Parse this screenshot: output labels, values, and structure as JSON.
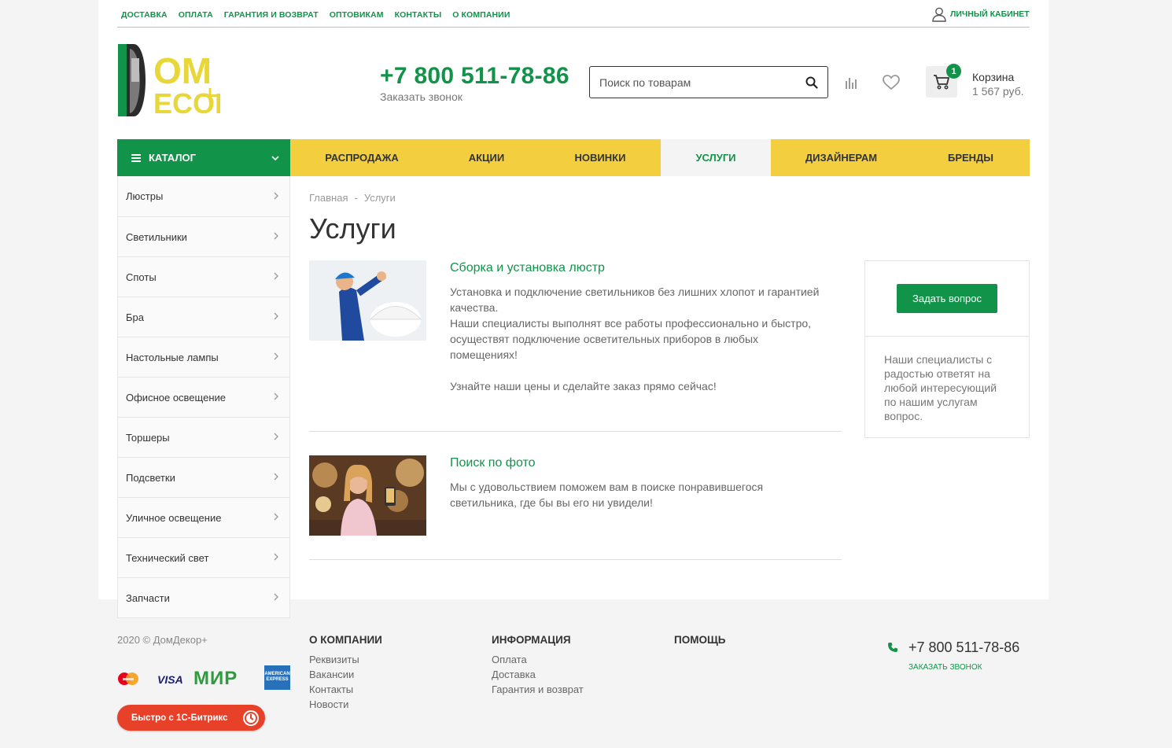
{
  "colors": {
    "brand_green": "#12934a",
    "nav_yellow": "#f3cf3f",
    "logo_yellow": "#e8d73a"
  },
  "topnav": {
    "items": [
      "ДОСТАВКА",
      "ОПЛАТА",
      "ГАРАНТИЯ И ВОЗВРАТ",
      "ОПТОВИКАМ",
      "КОНТАКТЫ",
      "О КОМПАНИИ"
    ],
    "cabinet": "ЛИЧНЫЙ КАБИНЕТ"
  },
  "logo": {
    "line1": "OM",
    "line2": "ECOR"
  },
  "header": {
    "phone": "+7 800 511-78-86",
    "callback": "Заказать звонок",
    "search_placeholder": "Поиск по товарам",
    "cart_count": "1",
    "cart_label": "Корзина",
    "cart_sum": "1 567 руб."
  },
  "catalog_label": "КАТАЛОГ",
  "mainnav": [
    {
      "label": "РАСПРОДАЖА",
      "width": 182
    },
    {
      "label": "АКЦИИ",
      "width": 135
    },
    {
      "label": "НОВИНКИ",
      "width": 154
    },
    {
      "label": "УСЛУГИ",
      "width": 140,
      "active": true
    },
    {
      "label": "ДИЗАЙНЕРАМ",
      "width": 179
    },
    {
      "label": "БРЕНДЫ",
      "width": 150
    }
  ],
  "sidebar": [
    "Люстры",
    "Светильники",
    "Споты",
    "Бра",
    "Настольные лампы",
    "Офисное освещение",
    "Торшеры",
    "Подсветки",
    "Уличное освещение",
    "Технический свет",
    "Запчасти"
  ],
  "breadcrumb": {
    "home": "Главная",
    "sep": "-",
    "current": "Услуги"
  },
  "page_title": "Услуги",
  "services": [
    {
      "title": "Сборка и установка люстр",
      "paragraphs": [
        "Установка и подключение светильников без лишних хлопот и гарантией качества.",
        "Наши специалисты выполнят все работы профессионально и быстро, осуществят подключение осветительных приборов в любых помещениях!",
        "",
        "Узнайте наши цены и сделайте заказ прямо сейчас!"
      ]
    },
    {
      "title": "Поиск по фото",
      "paragraphs": [
        "Мы с удовольствием поможем вам в поиске понравившегося светильника, где бы вы его ни увидели!"
      ]
    }
  ],
  "ask": {
    "button": "Задать вопрос",
    "text": "Наши специалисты с радостью ответят на любой интересующий по нашим услугам вопрос."
  },
  "footer": {
    "copyright": "2020 © ДомДекор+",
    "col1": {
      "title": "О КОМПАНИИ",
      "links": [
        "Реквизиты",
        "Вакансии",
        "Контакты",
        "Новости"
      ]
    },
    "col2": {
      "title": "ИНФОРМАЦИЯ",
      "links": [
        "Оплата",
        "Доставка",
        "Гарантия и возврат"
      ]
    },
    "col3": {
      "title": "ПОМОЩЬ",
      "links": []
    },
    "phone": "+7 800 511-78-86",
    "callback": "ЗАКАЗАТЬ ЗВОНОК",
    "payment": [
      "mastercard-icon",
      "VISA",
      "МИР",
      "AMERICAN EXPRESS"
    ],
    "bitrix": "Быстро с 1С-Битрикс"
  }
}
